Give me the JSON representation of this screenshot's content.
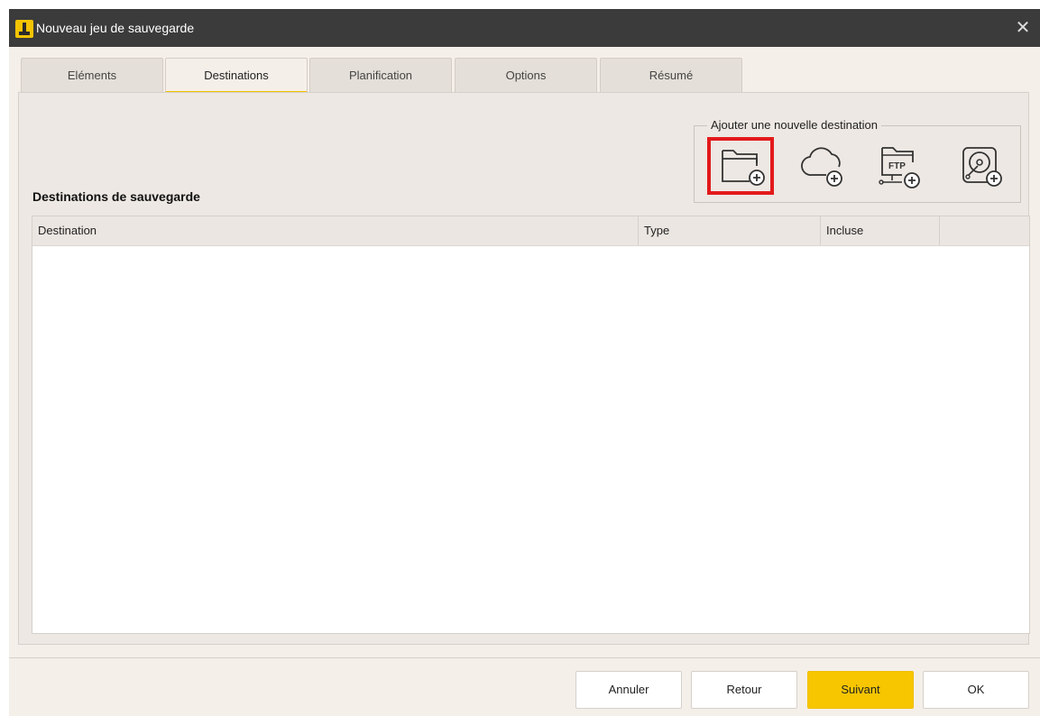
{
  "window": {
    "title": "Nouveau jeu de sauvegarde",
    "close_glyph": "✕"
  },
  "tabs": [
    {
      "label": "Eléments"
    },
    {
      "label": "Destinations",
      "active": true
    },
    {
      "label": "Planification"
    },
    {
      "label": "Options"
    },
    {
      "label": "Résumé"
    }
  ],
  "section_title": "Destinations de sauvegarde",
  "add_destination": {
    "label": "Ajouter une nouvelle destination",
    "buttons": [
      {
        "icon": "folder-add-icon",
        "highlighted": true
      },
      {
        "icon": "cloud-add-icon"
      },
      {
        "icon": "ftp-add-icon",
        "text": "FTP"
      },
      {
        "icon": "disk-add-icon"
      }
    ]
  },
  "table": {
    "columns": [
      "Destination",
      "Type",
      "Incluse",
      ""
    ],
    "rows": []
  },
  "footer": {
    "cancel": "Annuler",
    "back": "Retour",
    "next": "Suivant",
    "ok": "OK"
  },
  "colors": {
    "titlebar": "#3b3b3b",
    "accent": "#f7c600",
    "highlight": "#e3191b",
    "background": "#f5efe9"
  }
}
